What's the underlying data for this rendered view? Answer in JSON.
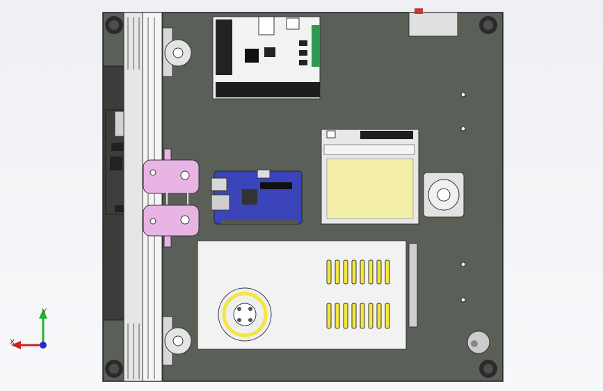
{
  "viewport": {
    "background_color": "#f1f3f5"
  },
  "scene": {
    "plate_color": "#5a5f58",
    "rail_color": "#e8e8e8",
    "mount_color": "#e7b4e4",
    "controller_board_color": "#f2f2f2",
    "pi_board_color": "#3b44b8",
    "power_supply_color": "#e8e8e8",
    "vent_slot_color": "#f2e640",
    "motor_icon": "stepper-motor-icon",
    "fan_icon": "fan-grille-icon"
  },
  "triad": {
    "x_label": "X",
    "y_label": "Y",
    "x_color": "#d02020",
    "y_color": "#20b030",
    "z_color": "#2030d0"
  }
}
